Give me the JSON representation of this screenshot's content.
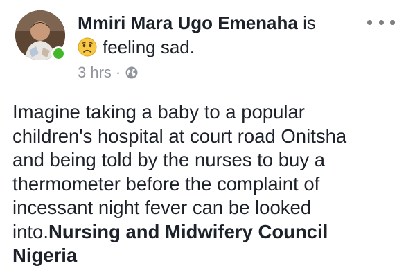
{
  "post": {
    "author_name": "Mmiri Mara Ugo Emenaha",
    "feeling_prefix": " is",
    "feeling_text": "feeling sad.",
    "feeling_icon": "sad-face-icon",
    "timestamp": "3 hrs",
    "separator": "·",
    "privacy_icon": "globe-icon",
    "more_icon": "more-options-icon",
    "body_lines": [
      "Imagine taking a baby to a popular",
      "children's hospital at court road Onitsha",
      "and being told by the nurses to buy a",
      "thermometer before the complaint of",
      "incessant night fever can be looked"
    ],
    "body_last_prefix": "into.",
    "tag_line1": "Nursing and Midwifery Council",
    "tag_line2": "Nigeria"
  },
  "colors": {
    "text": "#1d2129",
    "meta": "#90949c",
    "online": "#42b72a",
    "emoji": "#f7c843"
  }
}
